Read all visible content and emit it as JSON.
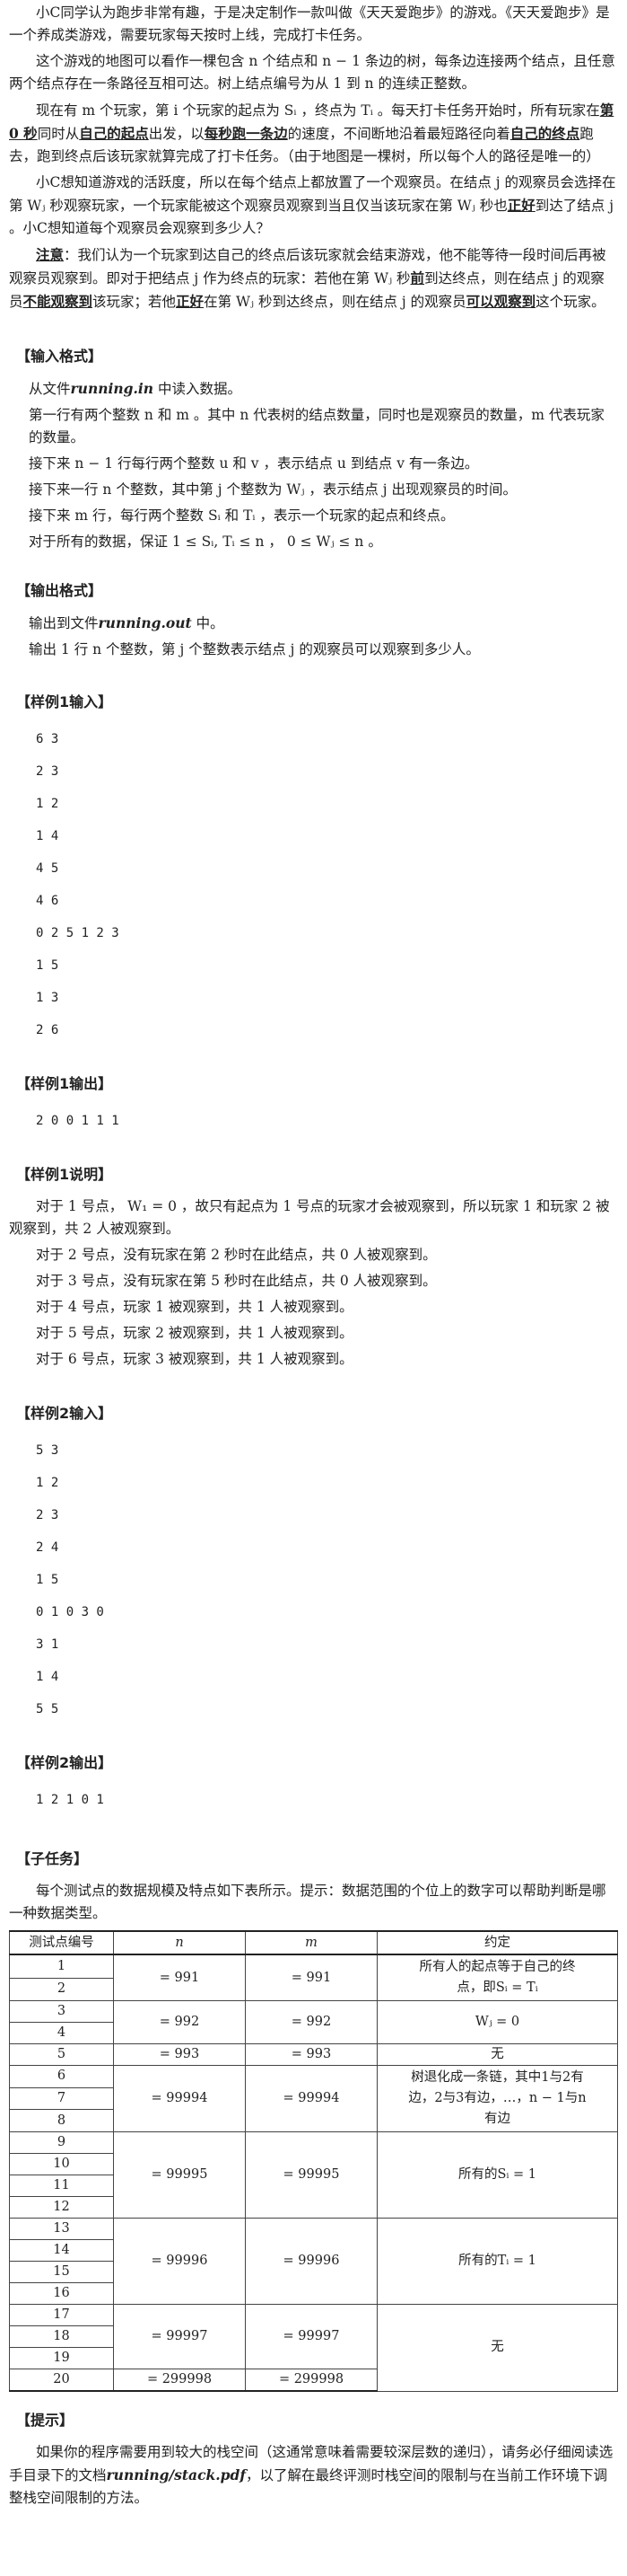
{
  "intro": {
    "p1": "小C同学认为跑步非常有趣，于是决定制作一款叫做《天天爱跑步》的游戏。《天天爱跑步》是一个养成类游戏，需要玩家每天按时上线，完成打卡任务。",
    "p2": "这个游戏的地图可以看作一棵包含 n 个结点和 n − 1 条边的树，每条边连接两个结点，且任意两个结点存在一条路径互相可达。树上结点编号为从 1 到 n 的连续正整数。",
    "p3a": "现在有 m 个玩家，第 i 个玩家的起点为 Sᵢ ，终点为 Tᵢ 。每天打卡任务开始时，所有玩家在",
    "p3u1": "第 0 秒",
    "p3b": "同时从",
    "p3u2": "自己的起点",
    "p3c": "出发，以",
    "p3u3": "每秒跑一条边",
    "p3d": "的速度，不间断地沿着最短路径向着",
    "p3u4": "自己的终点",
    "p3e": "跑去，跑到终点后该玩家就算完成了打卡任务。（由于地图是一棵树，所以每个人的路径是唯一的）",
    "p4a": "小C想知道游戏的活跃度，所以在每个结点上都放置了一个观察员。在结点 j 的观察员会选择在第 Wⱼ 秒观察玩家，一个玩家能被这个观察员观察到当且仅当该玩家在第 Wⱼ 秒也",
    "p4u": "正好",
    "p4b": "到达了结点 j 。小C想知道每个观察员会观察到多少人？",
    "p5label": "注意",
    "p5a": "：我们认为一个玩家到达自己的终点后该玩家就会结束游戏，他不能等待一段时间后再被观察员观察到。即对于把结点 j 作为终点的玩家：若他在第 Wⱼ 秒",
    "p5u1": "前",
    "p5b": "到达终点，则在结点 j 的观察员",
    "p5u2": "不能观察到",
    "p5c": "该玩家；若他",
    "p5u3": "正好",
    "p5d": "在第 Wⱼ 秒到达终点，则在结点 j 的观察员",
    "p5u4": "可以观察到",
    "p5e": "这个玩家。"
  },
  "input_format": {
    "heading": "【输入格式】",
    "l1a": "从文件",
    "l1file": "running.in",
    "l1b": " 中读入数据。",
    "l2": "第一行有两个整数 n 和 m 。其中 n 代表树的结点数量，同时也是观察员的数量，m 代表玩家的数量。",
    "l3": "接下来 n − 1 行每行两个整数 u 和 v ，表示结点 u 到结点 v 有一条边。",
    "l4": "接下来一行 n 个整数，其中第 j 个整数为 Wⱼ ，表示结点 j 出现观察员的时间。",
    "l5": "接下来 m 行，每行两个整数 Sᵢ 和 Tᵢ ，表示一个玩家的起点和终点。",
    "l6": "对于所有的数据，保证 1 ≤ Sᵢ, Tᵢ ≤ n ， 0 ≤ Wⱼ ≤ n 。"
  },
  "output_format": {
    "heading": "【输出格式】",
    "l1a": "输出到文件",
    "l1file": "running.out",
    "l1b": " 中。",
    "l2": "输出 1 行 n 个整数，第 j 个整数表示结点 j 的观察员可以观察到多少人。"
  },
  "sample1_input": {
    "heading": "【样例1输入】",
    "lines": [
      "6 3",
      "2 3",
      "1 2",
      "1 4",
      "4 5",
      "4 6",
      "0 2 5 1 2 3",
      "1 5",
      "1 3",
      "2 6"
    ]
  },
  "sample1_output": {
    "heading": "【样例1输出】",
    "lines": [
      "2 0 0 1 1 1"
    ]
  },
  "sample1_explain": {
    "heading": "【样例1说明】",
    "lines": [
      "对于 1 号点， W₁ = 0 ，故只有起点为 1 号点的玩家才会被观察到，所以玩家 1 和玩家 2 被观察到，共 2 人被观察到。",
      "对于 2 号点，没有玩家在第 2 秒时在此结点，共 0 人被观察到。",
      "对于 3 号点，没有玩家在第 5 秒时在此结点，共 0 人被观察到。",
      "对于 4 号点，玩家 1 被观察到，共 1 人被观察到。",
      "对于 5 号点，玩家 2 被观察到，共 1 人被观察到。",
      "对于 6 号点，玩家 3 被观察到，共 1 人被观察到。"
    ]
  },
  "sample2_input": {
    "heading": "【样例2输入】",
    "lines": [
      "5 3",
      "1 2",
      "2 3",
      "2 4",
      "1 5",
      "0 1 0 3 0",
      "3 1",
      "1 4",
      "5 5"
    ]
  },
  "sample2_output": {
    "heading": "【样例2输出】",
    "lines": [
      "1 2 1 0 1"
    ]
  },
  "subtasks": {
    "heading": "【子任务】",
    "desc": "每个测试点的数据规模及特点如下表所示。提示：数据范围的个位上的数字可以帮助判断是哪一种数据类型。",
    "headers": [
      "测试点编号",
      "n",
      "m",
      "约定"
    ],
    "ids": [
      "1",
      "2",
      "3",
      "4",
      "5",
      "6",
      "7",
      "8",
      "9",
      "10",
      "11",
      "12",
      "13",
      "14",
      "15",
      "16",
      "17",
      "18",
      "19",
      "20"
    ],
    "g1": {
      "n": "= 991",
      "m": "= 991",
      "c": "所有人的起点等于自己的终点，即Sᵢ = Tᵢ"
    },
    "g2": {
      "n": "= 992",
      "m": "= 992",
      "c": "Wⱼ = 0"
    },
    "g3": {
      "n": "= 993",
      "m": "= 993",
      "c": "无"
    },
    "g4": {
      "n": "= 99994",
      "m": "= 99994",
      "c": "树退化成一条链，其中1与2有边，2与3有边，…，n − 1与n有边"
    },
    "g5": {
      "n": "= 99995",
      "m": "= 99995",
      "c": "所有的Sᵢ = 1"
    },
    "g6": {
      "n": "= 99996",
      "m": "= 99996",
      "c": "所有的Tᵢ = 1"
    },
    "g7": {
      "n": "= 99997",
      "m": "= 99997",
      "c": "无"
    },
    "g8": {
      "n": "= 299998",
      "m": "= 299998"
    }
  },
  "hint": {
    "heading": "【提示】",
    "p1a": "如果你的程序需要用到较大的栈空间（这通常意味着需要较深层数的递归），请务必仔细阅读选手目录下的文档",
    "p1file": "running/stack.pdf",
    "p1b": "，以了解在最终评测时栈空间的限制与在当前工作环境下调整栈空间限制的方法。"
  }
}
